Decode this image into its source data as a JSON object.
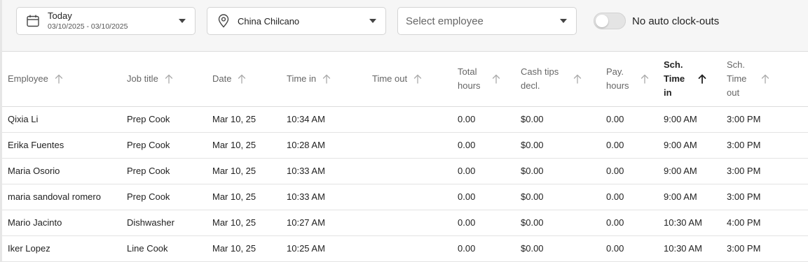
{
  "filters": {
    "date": {
      "title": "Today",
      "range": "03/10/2025 - 03/10/2025"
    },
    "location": {
      "value": "China Chilcano"
    },
    "employee": {
      "placeholder": "Select employee"
    },
    "toggle": {
      "label": "No auto clock-outs",
      "on": false
    }
  },
  "table": {
    "columns": [
      {
        "key": "employee",
        "label": "Employee",
        "sorted": false
      },
      {
        "key": "job",
        "label": "Job title",
        "sorted": false
      },
      {
        "key": "date",
        "label": "Date",
        "sorted": false
      },
      {
        "key": "time_in",
        "label": "Time in",
        "sorted": false
      },
      {
        "key": "time_out",
        "label": "Time out",
        "sorted": false
      },
      {
        "key": "total_hours",
        "label": "Total hours",
        "sorted": false
      },
      {
        "key": "cash_tips",
        "label": "Cash tips decl.",
        "sorted": false
      },
      {
        "key": "pay_hours",
        "label": "Pay. hours",
        "sorted": false
      },
      {
        "key": "sch_in",
        "label": "Sch. Time in",
        "sorted": true
      },
      {
        "key": "sch_out",
        "label": "Sch. Time out",
        "sorted": false
      }
    ],
    "rows": [
      {
        "employee": "Qixia Li",
        "job": "Prep Cook",
        "date": "Mar 10, 25",
        "time_in": "10:34 AM",
        "time_out": "",
        "total_hours": "0.00",
        "cash_tips": "$0.00",
        "pay_hours": "0.00",
        "sch_in": "9:00 AM",
        "sch_out": "3:00 PM"
      },
      {
        "employee": "Erika Fuentes",
        "job": "Prep Cook",
        "date": "Mar 10, 25",
        "time_in": "10:28 AM",
        "time_out": "",
        "total_hours": "0.00",
        "cash_tips": "$0.00",
        "pay_hours": "0.00",
        "sch_in": "9:00 AM",
        "sch_out": "3:00 PM"
      },
      {
        "employee": "Maria Osorio",
        "job": "Prep Cook",
        "date": "Mar 10, 25",
        "time_in": "10:33 AM",
        "time_out": "",
        "total_hours": "0.00",
        "cash_tips": "$0.00",
        "pay_hours": "0.00",
        "sch_in": "9:00 AM",
        "sch_out": "3:00 PM"
      },
      {
        "employee": "maria sandoval romero",
        "job": "Prep Cook",
        "date": "Mar 10, 25",
        "time_in": "10:33 AM",
        "time_out": "",
        "total_hours": "0.00",
        "cash_tips": "$0.00",
        "pay_hours": "0.00",
        "sch_in": "9:00 AM",
        "sch_out": "3:00 PM"
      },
      {
        "employee": "Mario Jacinto",
        "job": "Dishwasher",
        "date": "Mar 10, 25",
        "time_in": "10:27 AM",
        "time_out": "",
        "total_hours": "0.00",
        "cash_tips": "$0.00",
        "pay_hours": "0.00",
        "sch_in": "10:30 AM",
        "sch_out": "4:00 PM"
      },
      {
        "employee": "Iker Lopez",
        "job": "Line Cook",
        "date": "Mar 10, 25",
        "time_in": "10:25 AM",
        "time_out": "",
        "total_hours": "0.00",
        "cash_tips": "$0.00",
        "pay_hours": "0.00",
        "sch_in": "10:30 AM",
        "sch_out": "3:00 PM"
      }
    ]
  },
  "icons": {
    "date": "calendar-icon",
    "location": "location-pin-icon",
    "dropdown": "caret-down-icon",
    "sort": "arrow-up-icon"
  },
  "colors": {
    "header_text": "#666666",
    "sorted_header_text": "#222222",
    "body_text": "#222222",
    "filter_bar_bg": "#f6f6f6"
  }
}
